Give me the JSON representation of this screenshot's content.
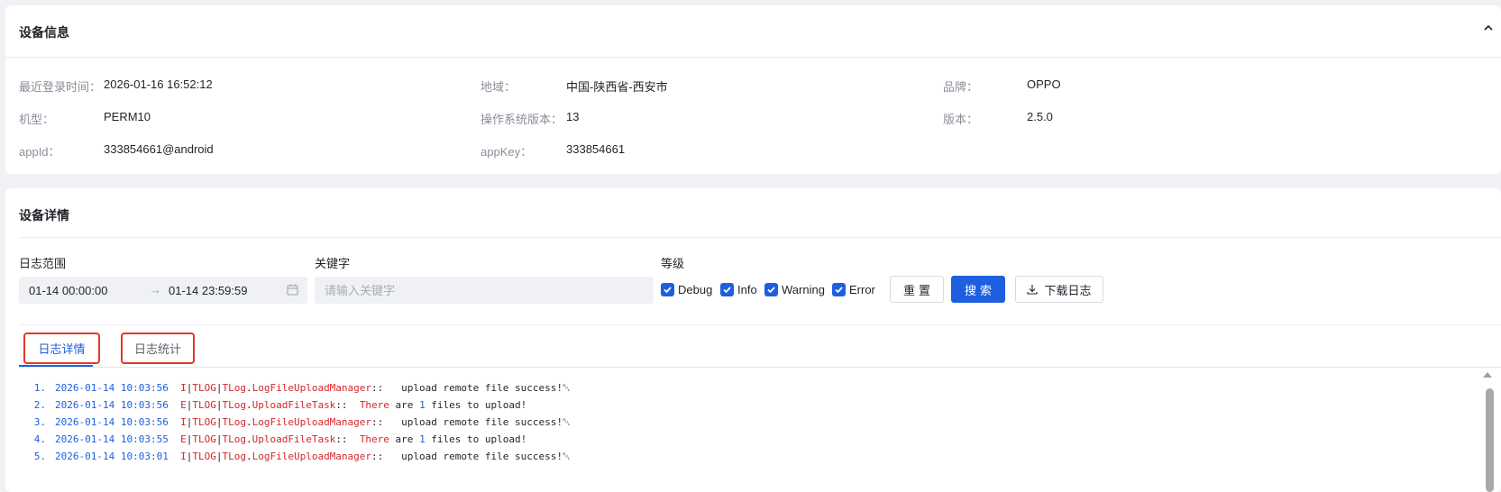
{
  "device_info": {
    "title": "设备信息",
    "rows": [
      {
        "label": "最近登录时间：",
        "value": "2026-01-16 16:52:12"
      },
      {
        "label": "地域：",
        "value": "中国-陕西省-西安市"
      },
      {
        "label": "品牌：",
        "value": "OPPO"
      },
      {
        "label": "机型：",
        "value": "PERM10"
      },
      {
        "label": "操作系统版本：",
        "value": "13"
      },
      {
        "label": "版本：",
        "value": "2.5.0"
      },
      {
        "label": "appId：",
        "value": "333854661@android"
      },
      {
        "label": "appKey：",
        "value": "333854661"
      }
    ]
  },
  "device_detail": {
    "title": "设备详情",
    "filters": {
      "range_label": "日志范围",
      "range_start": "01-14 00:00:00",
      "range_end": "01-14 23:59:59",
      "keyword_label": "关键字",
      "keyword_placeholder": "请输入关键字",
      "keyword_value": "",
      "level_label": "等级",
      "levels": [
        {
          "label": "Debug",
          "checked": true
        },
        {
          "label": "Info",
          "checked": true
        },
        {
          "label": "Warning",
          "checked": true
        },
        {
          "label": "Error",
          "checked": true
        }
      ]
    },
    "buttons": {
      "reset": "重置",
      "search": "搜索",
      "download": "下载日志"
    },
    "tabs": [
      {
        "label": "日志详情",
        "active": true
      },
      {
        "label": "日志统计",
        "active": false
      }
    ],
    "logs": [
      {
        "no": "1.",
        "time": "2026-01-14 10:03:56",
        "level": "I",
        "tag": "TLOG",
        "module": "TLog",
        "class": "LogFileUploadManager",
        "message": "upload remote file success!␀"
      },
      {
        "no": "2.",
        "time": "2026-01-14 10:03:56",
        "level": "E",
        "tag": "TLOG",
        "module": "TLog",
        "class": "UploadFileTask",
        "message": "There are 1 files to upload!"
      },
      {
        "no": "3.",
        "time": "2026-01-14 10:03:56",
        "level": "I",
        "tag": "TLOG",
        "module": "TLog",
        "class": "LogFileUploadManager",
        "message": "upload remote file success!␀"
      },
      {
        "no": "4.",
        "time": "2026-01-14 10:03:55",
        "level": "E",
        "tag": "TLOG",
        "module": "TLog",
        "class": "UploadFileTask",
        "message": "There are 1 files to upload!"
      },
      {
        "no": "5.",
        "time": "2026-01-14 10:03:01",
        "level": "I",
        "tag": "TLOG",
        "module": "TLog",
        "class": "LogFileUploadManager",
        "message": "upload remote file success!␀"
      }
    ]
  },
  "colors": {
    "accent": "#1d5fe0",
    "error_red": "#d6262b",
    "highlight_border": "#e0392b"
  },
  "icons": [
    "chevron-up-icon",
    "calendar-icon",
    "checkbox-checked-icon",
    "download-icon"
  ]
}
